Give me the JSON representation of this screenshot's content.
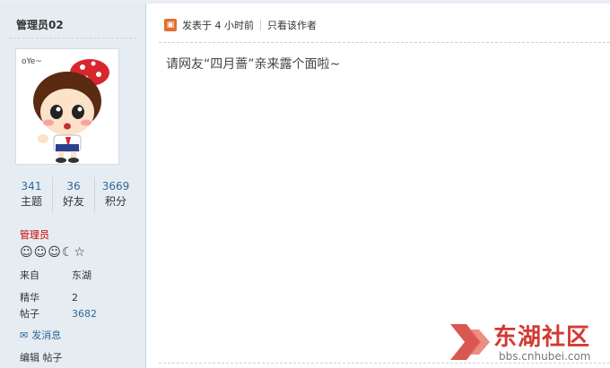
{
  "user": {
    "name": "管理员02",
    "stats": [
      {
        "num": "341",
        "label": "主题"
      },
      {
        "num": "36",
        "label": "好友"
      },
      {
        "num": "3669",
        "label": "积分"
      }
    ],
    "group": "管理员",
    "from_label": "来自",
    "from_value": "东湖",
    "jinghua_label": "精华",
    "jinghua_value": "2",
    "posts_label": "帖子",
    "posts_value": "3682",
    "message_label": "发消息",
    "edit_label": "编辑",
    "posts_link_label": "帖子"
  },
  "post": {
    "time": "发表于 4 小时前",
    "only_author": "只看该作者",
    "body": "请网友“四月蔷”亲来露个面啦~"
  },
  "watermark": {
    "site_name": "东湖社区",
    "url": "bbs.cnhubei.com"
  }
}
